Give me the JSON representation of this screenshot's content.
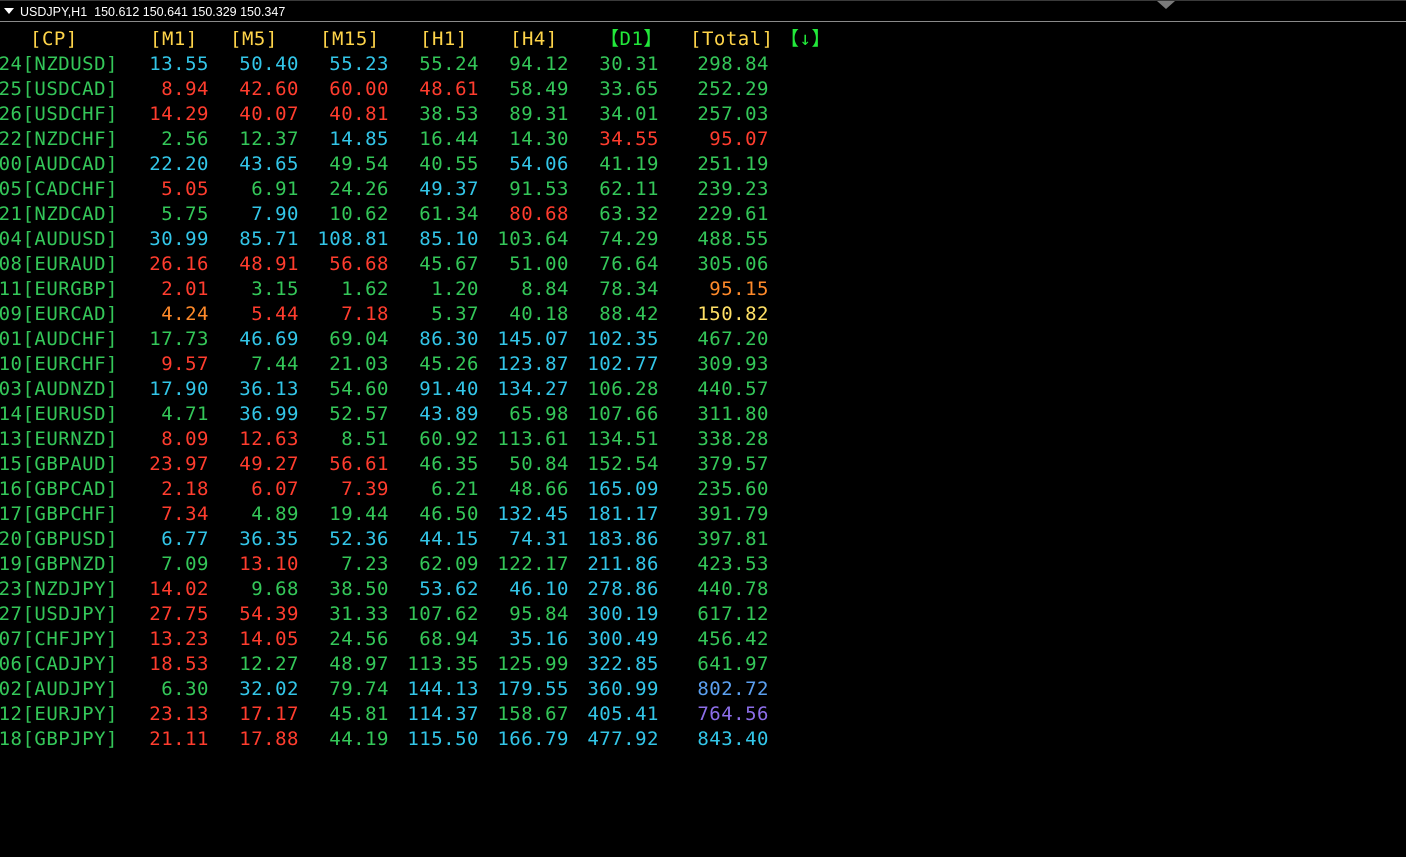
{
  "chart_header": {
    "symbol_timeframe": "USDJPY,H1",
    "ohlc": "150.612 150.641 150.329 150.347"
  },
  "headers": [
    {
      "label": "[CP]",
      "color": "#ffd54a"
    },
    {
      "label": "[M1]",
      "color": "#ffd54a"
    },
    {
      "label": "[M5]",
      "color": "#ffd54a"
    },
    {
      "label": "[M15]",
      "color": "#ffd54a"
    },
    {
      "label": "[H1]",
      "color": "#ffd54a"
    },
    {
      "label": "[H4]",
      "color": "#ffd54a"
    },
    {
      "label": "【D1】",
      "color": "#22e83a"
    },
    {
      "label": "[Total]",
      "color": "#ffd54a"
    },
    {
      "label": "【↓】",
      "color": "#22e83a"
    }
  ],
  "colors": {
    "red": "#ff3d2e",
    "green": "#34c759",
    "cyan": "#33c6e8",
    "orange": "#ff8a2a",
    "yellow": "#ffe066",
    "blue": "#5ba0f0",
    "purple": "#8c6ee8"
  },
  "rows": [
    {
      "pair": "24[NZDUSD]",
      "values": [
        "13.55",
        "50.40",
        "55.23",
        "55.24",
        "94.12",
        "30.31",
        "298.84"
      ],
      "colors": [
        "cyan",
        "cyan",
        "cyan",
        "green",
        "green",
        "green",
        "green"
      ]
    },
    {
      "pair": "25[USDCAD]",
      "values": [
        "8.94",
        "42.60",
        "60.00",
        "48.61",
        "58.49",
        "33.65",
        "252.29"
      ],
      "colors": [
        "red",
        "red",
        "red",
        "red",
        "green",
        "green",
        "green"
      ]
    },
    {
      "pair": "26[USDCHF]",
      "values": [
        "14.29",
        "40.07",
        "40.81",
        "38.53",
        "89.31",
        "34.01",
        "257.03"
      ],
      "colors": [
        "red",
        "red",
        "red",
        "green",
        "green",
        "green",
        "green"
      ]
    },
    {
      "pair": "22[NZDCHF]",
      "values": [
        "2.56",
        "12.37",
        "14.85",
        "16.44",
        "14.30",
        "34.55",
        "95.07"
      ],
      "colors": [
        "green",
        "green",
        "cyan",
        "green",
        "green",
        "red",
        "red"
      ]
    },
    {
      "pair": "00[AUDCAD]",
      "values": [
        "22.20",
        "43.65",
        "49.54",
        "40.55",
        "54.06",
        "41.19",
        "251.19"
      ],
      "colors": [
        "cyan",
        "cyan",
        "green",
        "green",
        "cyan",
        "green",
        "green"
      ]
    },
    {
      "pair": "05[CADCHF]",
      "values": [
        "5.05",
        "6.91",
        "24.26",
        "49.37",
        "91.53",
        "62.11",
        "239.23"
      ],
      "colors": [
        "red",
        "green",
        "green",
        "cyan",
        "green",
        "green",
        "green"
      ]
    },
    {
      "pair": "21[NZDCAD]",
      "values": [
        "5.75",
        "7.90",
        "10.62",
        "61.34",
        "80.68",
        "63.32",
        "229.61"
      ],
      "colors": [
        "green",
        "cyan",
        "green",
        "green",
        "red",
        "green",
        "green"
      ]
    },
    {
      "pair": "04[AUDUSD]",
      "values": [
        "30.99",
        "85.71",
        "108.81",
        "85.10",
        "103.64",
        "74.29",
        "488.55"
      ],
      "colors": [
        "cyan",
        "cyan",
        "cyan",
        "cyan",
        "green",
        "green",
        "green"
      ]
    },
    {
      "pair": "08[EURAUD]",
      "values": [
        "26.16",
        "48.91",
        "56.68",
        "45.67",
        "51.00",
        "76.64",
        "305.06"
      ],
      "colors": [
        "red",
        "red",
        "red",
        "green",
        "green",
        "green",
        "green"
      ]
    },
    {
      "pair": "11[EURGBP]",
      "values": [
        "2.01",
        "3.15",
        "1.62",
        "1.20",
        "8.84",
        "78.34",
        "95.15"
      ],
      "colors": [
        "red",
        "green",
        "green",
        "green",
        "green",
        "green",
        "orange"
      ]
    },
    {
      "pair": "09[EURCAD]",
      "values": [
        "4.24",
        "5.44",
        "7.18",
        "5.37",
        "40.18",
        "88.42",
        "150.82"
      ],
      "colors": [
        "orange",
        "red",
        "red",
        "green",
        "green",
        "green",
        "yellow"
      ]
    },
    {
      "pair": "01[AUDCHF]",
      "values": [
        "17.73",
        "46.69",
        "69.04",
        "86.30",
        "145.07",
        "102.35",
        "467.20"
      ],
      "colors": [
        "green",
        "cyan",
        "green",
        "cyan",
        "cyan",
        "cyan",
        "green"
      ]
    },
    {
      "pair": "10[EURCHF]",
      "values": [
        "9.57",
        "7.44",
        "21.03",
        "45.26",
        "123.87",
        "102.77",
        "309.93"
      ],
      "colors": [
        "red",
        "green",
        "green",
        "green",
        "cyan",
        "cyan",
        "green"
      ]
    },
    {
      "pair": "03[AUDNZD]",
      "values": [
        "17.90",
        "36.13",
        "54.60",
        "91.40",
        "134.27",
        "106.28",
        "440.57"
      ],
      "colors": [
        "cyan",
        "cyan",
        "green",
        "cyan",
        "cyan",
        "green",
        "green"
      ]
    },
    {
      "pair": "14[EURUSD]",
      "values": [
        "4.71",
        "36.99",
        "52.57",
        "43.89",
        "65.98",
        "107.66",
        "311.80"
      ],
      "colors": [
        "green",
        "cyan",
        "green",
        "cyan",
        "green",
        "green",
        "green"
      ]
    },
    {
      "pair": "13[EURNZD]",
      "values": [
        "8.09",
        "12.63",
        "8.51",
        "60.92",
        "113.61",
        "134.51",
        "338.28"
      ],
      "colors": [
        "red",
        "red",
        "green",
        "green",
        "green",
        "green",
        "green"
      ]
    },
    {
      "pair": "15[GBPAUD]",
      "values": [
        "23.97",
        "49.27",
        "56.61",
        "46.35",
        "50.84",
        "152.54",
        "379.57"
      ],
      "colors": [
        "red",
        "red",
        "red",
        "green",
        "green",
        "green",
        "green"
      ]
    },
    {
      "pair": "16[GBPCAD]",
      "values": [
        "2.18",
        "6.07",
        "7.39",
        "6.21",
        "48.66",
        "165.09",
        "235.60"
      ],
      "colors": [
        "red",
        "red",
        "red",
        "green",
        "green",
        "cyan",
        "green"
      ]
    },
    {
      "pair": "17[GBPCHF]",
      "values": [
        "7.34",
        "4.89",
        "19.44",
        "46.50",
        "132.45",
        "181.17",
        "391.79"
      ],
      "colors": [
        "red",
        "green",
        "green",
        "green",
        "cyan",
        "cyan",
        "green"
      ]
    },
    {
      "pair": "20[GBPUSD]",
      "values": [
        "6.77",
        "36.35",
        "52.36",
        "44.15",
        "74.31",
        "183.86",
        "397.81"
      ],
      "colors": [
        "cyan",
        "cyan",
        "cyan",
        "cyan",
        "cyan",
        "cyan",
        "green"
      ]
    },
    {
      "pair": "19[GBPNZD]",
      "values": [
        "7.09",
        "13.10",
        "7.23",
        "62.09",
        "122.17",
        "211.86",
        "423.53"
      ],
      "colors": [
        "green",
        "red",
        "green",
        "green",
        "green",
        "cyan",
        "green"
      ]
    },
    {
      "pair": "23[NZDJPY]",
      "values": [
        "14.02",
        "9.68",
        "38.50",
        "53.62",
        "46.10",
        "278.86",
        "440.78"
      ],
      "colors": [
        "red",
        "green",
        "green",
        "cyan",
        "cyan",
        "cyan",
        "green"
      ]
    },
    {
      "pair": "27[USDJPY]",
      "values": [
        "27.75",
        "54.39",
        "31.33",
        "107.62",
        "95.84",
        "300.19",
        "617.12"
      ],
      "colors": [
        "red",
        "red",
        "green",
        "green",
        "green",
        "cyan",
        "green"
      ]
    },
    {
      "pair": "07[CHFJPY]",
      "values": [
        "13.23",
        "14.05",
        "24.56",
        "68.94",
        "35.16",
        "300.49",
        "456.42"
      ],
      "colors": [
        "red",
        "red",
        "green",
        "green",
        "cyan",
        "cyan",
        "green"
      ]
    },
    {
      "pair": "06[CADJPY]",
      "values": [
        "18.53",
        "12.27",
        "48.97",
        "113.35",
        "125.99",
        "322.85",
        "641.97"
      ],
      "colors": [
        "red",
        "green",
        "green",
        "green",
        "green",
        "cyan",
        "green"
      ]
    },
    {
      "pair": "02[AUDJPY]",
      "values": [
        "6.30",
        "32.02",
        "79.74",
        "144.13",
        "179.55",
        "360.99",
        "802.72"
      ],
      "colors": [
        "green",
        "cyan",
        "green",
        "cyan",
        "cyan",
        "cyan",
        "blue"
      ]
    },
    {
      "pair": "12[EURJPY]",
      "values": [
        "23.13",
        "17.17",
        "45.81",
        "114.37",
        "158.67",
        "405.41",
        "764.56"
      ],
      "colors": [
        "red",
        "red",
        "green",
        "cyan",
        "green",
        "cyan",
        "purple"
      ]
    },
    {
      "pair": "18[GBPJPY]",
      "values": [
        "21.11",
        "17.88",
        "44.19",
        "115.50",
        "166.79",
        "477.92",
        "843.40"
      ],
      "colors": [
        "red",
        "red",
        "green",
        "cyan",
        "cyan",
        "cyan",
        "cyan"
      ]
    }
  ]
}
